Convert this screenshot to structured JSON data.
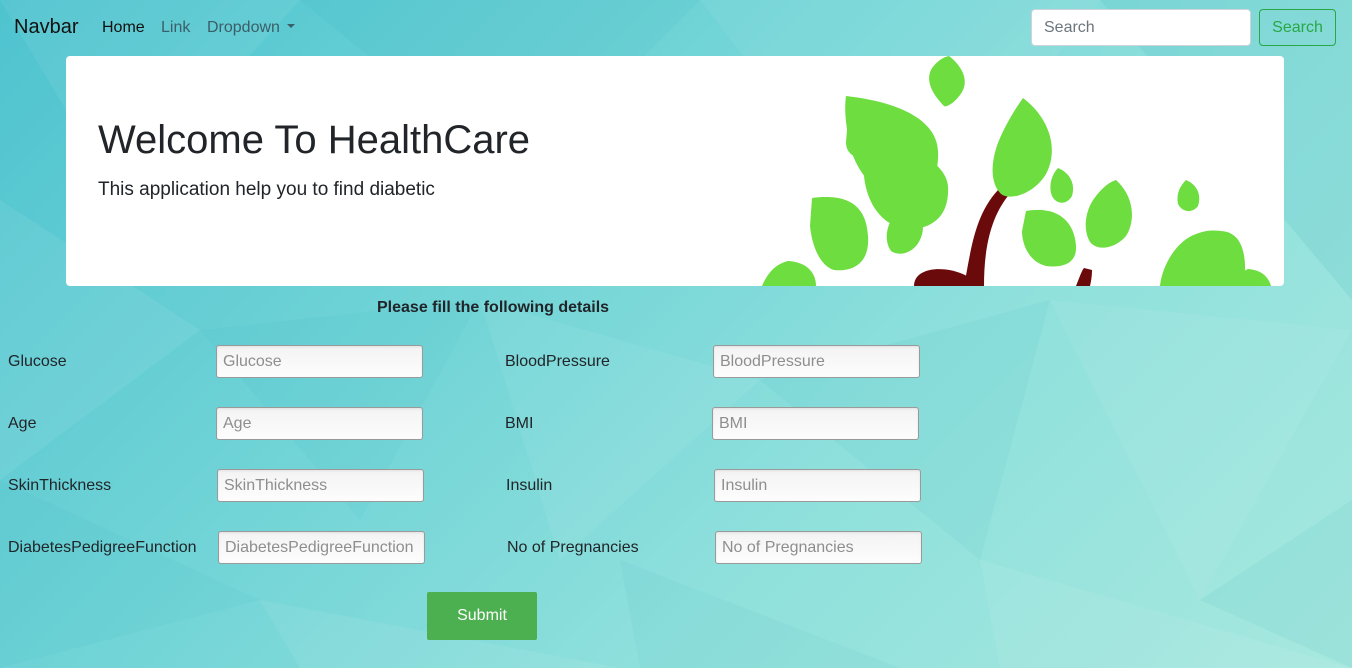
{
  "navbar": {
    "brand": "Navbar",
    "links": [
      "Home",
      "Link",
      "Dropdown"
    ],
    "search_placeholder": "Search",
    "search_button": "Search"
  },
  "jumbotron": {
    "title": "Welcome To HealthCare",
    "lead": "This application help you to find diabetic"
  },
  "form": {
    "heading": "Please fill the following details",
    "fields": [
      {
        "label": "Glucose",
        "placeholder": "Glucose"
      },
      {
        "label": "BloodPressure",
        "placeholder": "BloodPressure"
      },
      {
        "label": "Age",
        "placeholder": "Age"
      },
      {
        "label": "BMI",
        "placeholder": "BMI"
      },
      {
        "label": "SkinThickness",
        "placeholder": "SkinThickness"
      },
      {
        "label": "Insulin",
        "placeholder": "Insulin"
      },
      {
        "label": "DiabetesPedigreeFunction",
        "placeholder": "DiabetesPedigreeFunction"
      },
      {
        "label": "No of Pregnancies",
        "placeholder": "No of Pregnancies"
      }
    ],
    "submit": "Submit"
  },
  "colors": {
    "accent_green": "#4caf50",
    "outline_green": "#28a745",
    "leaf_green": "#6ddd3f",
    "trunk": "#6b0a0a",
    "background_teal": "#6fd3d6"
  }
}
